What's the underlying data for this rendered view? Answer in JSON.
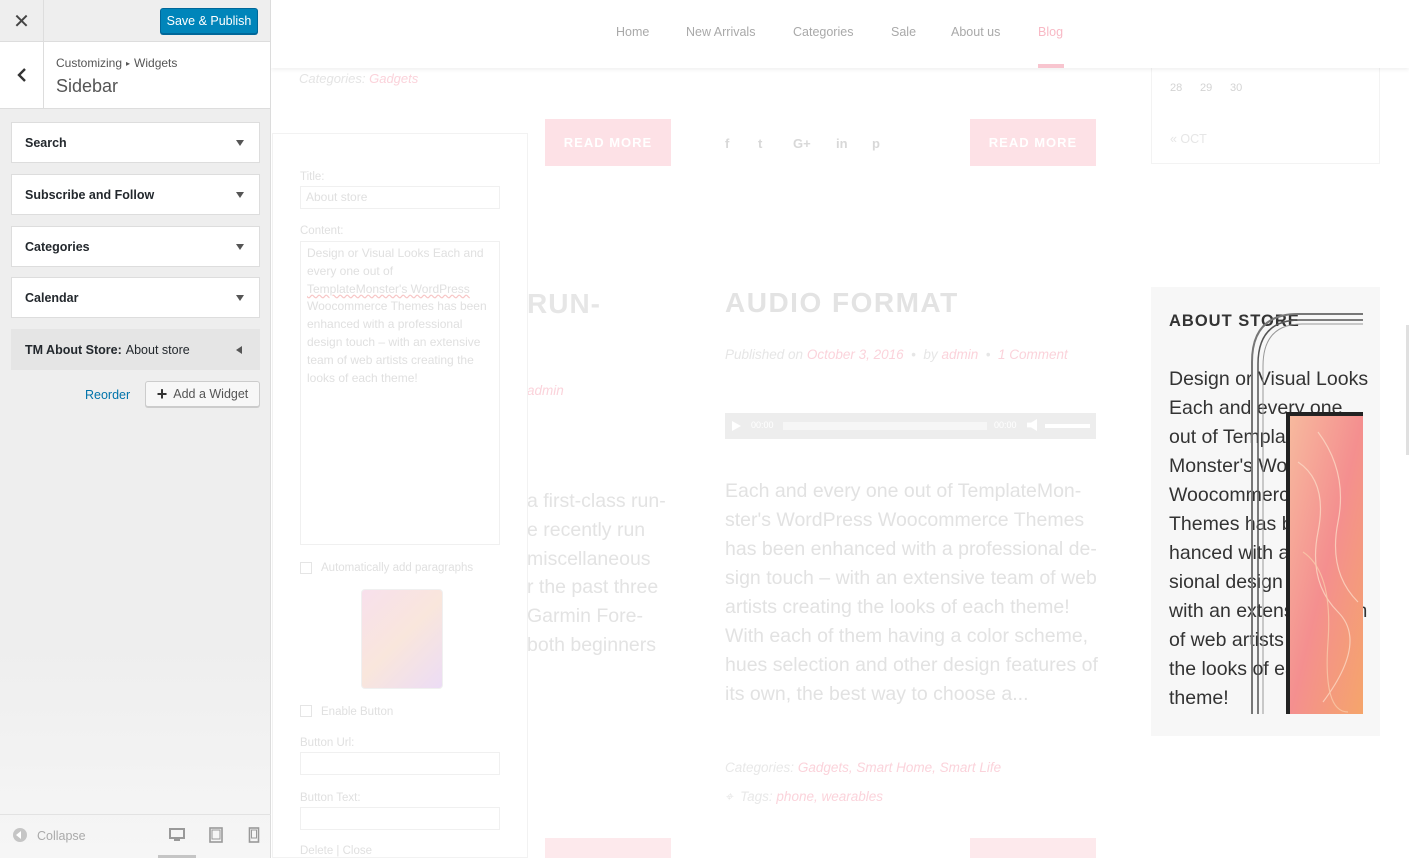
{
  "customizer": {
    "close_icon": "close-icon",
    "publish_label": "Save & Publish",
    "breadcrumb": {
      "parent": "Customizing",
      "separator": "▸",
      "child": "Widgets"
    },
    "section_title": "Sidebar",
    "widgets": [
      {
        "title": "Search"
      },
      {
        "title": "Subscribe and Follow"
      },
      {
        "title": "Categories"
      },
      {
        "title": "Calendar"
      },
      {
        "title": "TM About Store:",
        "subtitle": "About store"
      }
    ],
    "reorder_label": "Reorder",
    "add_widget_label": "Add a Widget",
    "collapse_label": "Collapse",
    "accent_color": "#0085ba"
  },
  "preview": {
    "nav": [
      {
        "label": "Home"
      },
      {
        "label": "New Arrivals"
      },
      {
        "label": "Categories"
      },
      {
        "label": "Sale"
      },
      {
        "label": "About us"
      },
      {
        "label": "Blog",
        "active": true
      }
    ],
    "top_categories": {
      "prefix": "Categories:",
      "value": "Gadgets"
    },
    "read_more": "READ MORE",
    "social_icons": [
      "f",
      "t",
      "G+",
      "in",
      "p"
    ],
    "edit_form": {
      "title_label": "Title:",
      "title_value": "About store",
      "content_label": "Content:",
      "content_lines": [
        "Design or Visual Looks Each and",
        "every one out of",
        "TemplateMonster's WordPress",
        "Woocommerce Themes has been",
        "enhanced with a professional",
        "design touch – with an extensive",
        "team of web artists creating the",
        "looks of each theme!"
      ],
      "auto_paragraphs": "Automatically add paragraphs",
      "enable_button": "Enable Button",
      "button_url_label": "Button Url:",
      "button_text_label": "Button Text:",
      "delete_close": "Delete | Close"
    },
    "left_post": {
      "title": "RUN-",
      "meta_author": "admin",
      "lines": [
        "a first-class run-",
        "e recently run",
        "miscellaneous",
        "r the past three",
        "Garmin Fore-",
        "both beginners"
      ]
    },
    "audio_post": {
      "title": "AUDIO FORMAT",
      "published_prefix": "Published on",
      "date": "October 3, 2016",
      "by_prefix": "by",
      "author": "admin",
      "comments": "1 Comment",
      "time_start": "00:00",
      "time_end": "00:00",
      "excerpt": "Each and every one out of TemplateMon-ster's WordPress Woocommerce Themes has been enhanced with a professional de-sign touch – with an extensive team of web artists creating the looks of each theme! With each of them having a color scheme, hues selection and other design features of its own, the best way to choose a...",
      "categories_prefix": "Categories:",
      "categories": "Gadgets, Smart Home, Smart Life",
      "tags_prefix": "Tags:",
      "tags": "phone, wearables"
    },
    "calendar": {
      "days": [
        "28",
        "29",
        "30"
      ],
      "prev": "« OCT"
    },
    "about_store": {
      "title": "ABOUT STORE",
      "text": "Design or Visual Looks Each and every one out of Template-Monster's WordPress Woocommerce Themes has been en-hanced with a profes-sional design touch – with an extensive team of web artists creating the looks of each theme!"
    }
  }
}
